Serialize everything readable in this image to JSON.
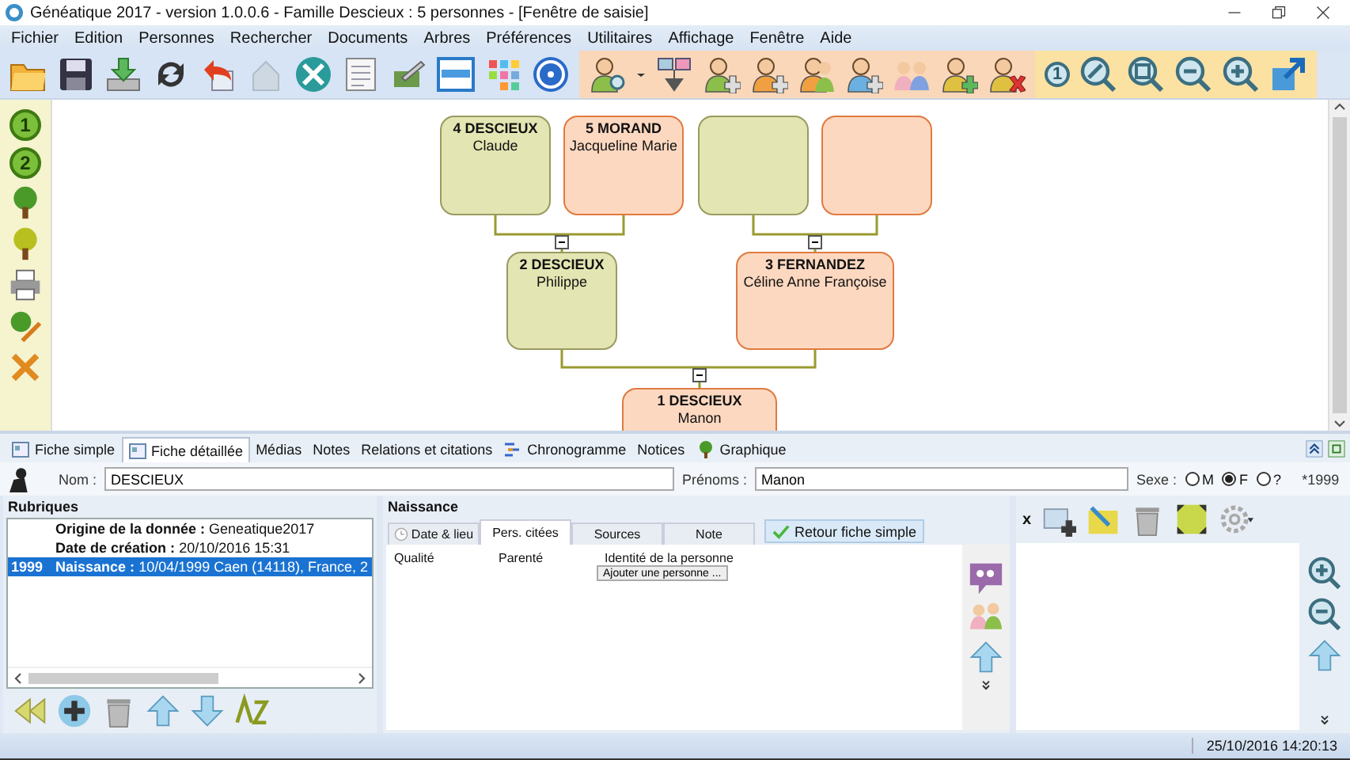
{
  "window": {
    "title": "Généatique 2017 - version 1.0.0.6 - Famille Descieux : 5 personnes - [Fenêtre de saisie]"
  },
  "menu": [
    "Fichier",
    "Edition",
    "Personnes",
    "Rechercher",
    "Documents",
    "Arbres",
    "Préférences",
    "Utilitaires",
    "Affichage",
    "Fenêtre",
    "Aide"
  ],
  "toolbar": {
    "zoom_label": "1"
  },
  "side_toolbar": {
    "generation_labels": [
      "1",
      "2"
    ]
  },
  "tree": {
    "nodes": [
      {
        "kind": "male",
        "surname": "4 DESCIEUX",
        "given": "Claude"
      },
      {
        "kind": "female",
        "surname": "5 MORAND",
        "given": "Jacqueline Marie"
      },
      {
        "kind": "male"
      },
      {
        "kind": "female"
      },
      {
        "kind": "male",
        "surname": "2 DESCIEUX",
        "given": "Philippe"
      },
      {
        "kind": "female",
        "surname": "3 FERNANDEZ",
        "given": "Céline Anne Françoise"
      },
      {
        "kind": "female",
        "surname": "1 DESCIEUX",
        "given": "Manon"
      }
    ]
  },
  "tabs": [
    {
      "label": "Fiche simple",
      "kind": "card",
      "selected": false
    },
    {
      "label": "Fiche détaillée",
      "kind": "card",
      "selected": true
    },
    {
      "label": "Médias",
      "kind": "plain",
      "selected": false
    },
    {
      "label": "Notes",
      "kind": "plain",
      "selected": false
    },
    {
      "label": "Relations et citations",
      "kind": "plain",
      "selected": false
    },
    {
      "label": "Chronogramme",
      "kind": "timeline",
      "selected": false
    },
    {
      "label": "Notices",
      "kind": "plain",
      "selected": false
    },
    {
      "label": "Graphique",
      "kind": "tree",
      "selected": false
    }
  ],
  "identity": {
    "surname_label": "Nom :",
    "surname": "DESCIEUX",
    "given_label": "Prénoms :",
    "given": "Manon",
    "sex_label": "Sexe :",
    "sex_options": [
      {
        "label": "M",
        "selected": false
      },
      {
        "label": "F",
        "selected": true
      },
      {
        "label": "?",
        "selected": false
      }
    ],
    "birth_year": "*1999"
  },
  "rubriques": {
    "title": "Rubriques",
    "rows": [
      {
        "label": "Origine de la donnée",
        "separator": ":",
        "value": "Geneatique2017",
        "selected": false
      },
      {
        "label": "Date de création",
        "separator": ":",
        "value": "20/10/2016 15:31",
        "selected": false
      },
      {
        "year": "1999",
        "label": "Naissance",
        "separator": ":",
        "value": "10/04/1999 Caen (14118), France, 2",
        "selected": true
      }
    ]
  },
  "event": {
    "title": "Naissance",
    "subtabs": [
      {
        "label": "Date & lieu",
        "kind": "clock",
        "selected": false
      },
      {
        "label": "Pers. citées",
        "kind": "plain",
        "selected": true
      },
      {
        "label": "Sources",
        "kind": "plain",
        "selected": false
      },
      {
        "label": "Note",
        "kind": "plain",
        "selected": false
      }
    ],
    "back_button": "Retour fiche simple",
    "columns": [
      "Qualité",
      "Parenté",
      "Identité de la personne"
    ],
    "add_button": "Ajouter une personne ..."
  },
  "media": {
    "close_label": "x"
  },
  "status_bar": {
    "datetime": "25/10/2016 14:20:13"
  }
}
